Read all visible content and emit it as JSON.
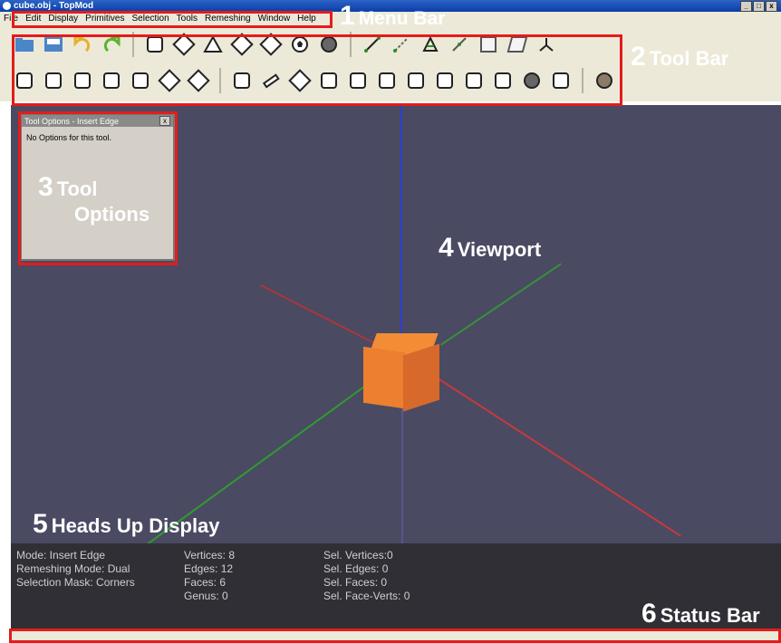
{
  "window": {
    "title": "cube.obj - TopMod",
    "controls": [
      "_",
      "□",
      "x"
    ]
  },
  "menu": [
    "File",
    "Edit",
    "Display",
    "Primitives",
    "Selection",
    "Tools",
    "Remeshing",
    "Window",
    "Help"
  ],
  "tool_options": {
    "title": "Tool Options - Insert Edge",
    "close": "x",
    "message": "No Options for this tool."
  },
  "hud": {
    "left": [
      "Mode: Insert Edge",
      "Remeshing Mode: Dual",
      "Selection Mask: Corners"
    ],
    "middle": [
      "Vertices: 8",
      "Edges: 12",
      "Faces: 6",
      "Genus: 0"
    ],
    "right": [
      "Sel. Vertices:0",
      "Sel. Edges: 0",
      "Sel. Faces: 0",
      "Sel. Face-Verts: 0"
    ]
  },
  "annotations": [
    {
      "num": "1",
      "text": "Menu Bar"
    },
    {
      "num": "2",
      "text": "Tool Bar"
    },
    {
      "num": "3",
      "text": "Tool",
      "text2": "Options"
    },
    {
      "num": "4",
      "text": "Viewport"
    },
    {
      "num": "5",
      "text": "Heads Up Display"
    },
    {
      "num": "6",
      "text": "Status Bar"
    }
  ],
  "colors": {
    "annotation_red": "#e51b1b",
    "viewport_bg": "#4a4a63",
    "cube_orange": "#f28d36",
    "axis_blue": "#2c3fd0",
    "axis_red": "#c73a3a",
    "axis_green": "#2f9c2f"
  }
}
